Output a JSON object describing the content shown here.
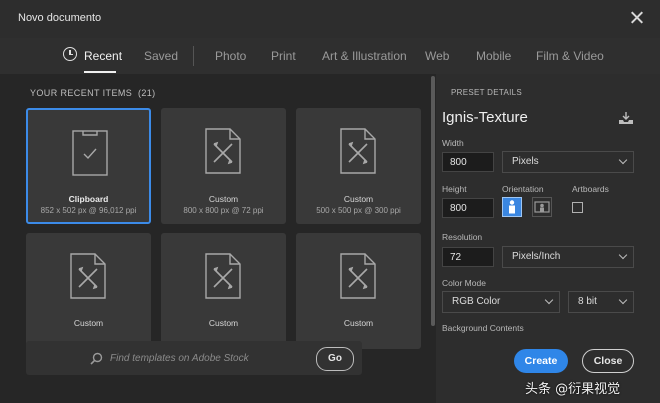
{
  "window": {
    "title": "Novo documento"
  },
  "tabs": [
    {
      "label": "Recent",
      "active": true
    },
    {
      "label": "Saved"
    },
    {
      "label": "Photo"
    },
    {
      "label": "Print"
    },
    {
      "label": "Art & Illustration"
    },
    {
      "label": "Web"
    },
    {
      "label": "Mobile"
    },
    {
      "label": "Film & Video"
    }
  ],
  "recent": {
    "heading": "YOUR RECENT ITEMS",
    "count": "(21)",
    "items": [
      {
        "name": "Clipboard",
        "dims": "852 x 502 px @ 96,012 ppi",
        "icon": "clipboard-icon",
        "selected": true
      },
      {
        "name": "Custom",
        "dims": "800 x 800 px @ 72 ppi",
        "icon": "custom-document-icon"
      },
      {
        "name": "Custom",
        "dims": "500 x 500 px @ 300 ppi",
        "icon": "custom-document-icon"
      },
      {
        "name": "Custom",
        "dims": "",
        "icon": "custom-document-icon"
      },
      {
        "name": "Custom",
        "dims": "",
        "icon": "custom-document-icon"
      },
      {
        "name": "Custom",
        "dims": "",
        "icon": "custom-document-icon"
      }
    ]
  },
  "search": {
    "placeholder": "Find templates on Adobe Stock",
    "button": "Go"
  },
  "preset": {
    "header": "PRESET DETAILS",
    "name": "Ignis-Texture",
    "width_label": "Width",
    "width_value": "800",
    "width_unit": "Pixels",
    "height_label": "Height",
    "height_value": "800",
    "orientation_label": "Orientation",
    "artboards_label": "Artboards",
    "resolution_label": "Resolution",
    "resolution_value": "72",
    "resolution_unit": "Pixels/Inch",
    "color_mode_label": "Color Mode",
    "color_mode": "RGB Color",
    "bit_depth": "8 bit",
    "background_label": "Background Contents"
  },
  "actions": {
    "create": "Create",
    "close": "Close"
  },
  "watermark": "头条 @衍果视觉",
  "colors": {
    "accent": "#2f86e8",
    "panel": "#2d2d2d",
    "grid_bg": "#262626",
    "card": "#393939"
  }
}
